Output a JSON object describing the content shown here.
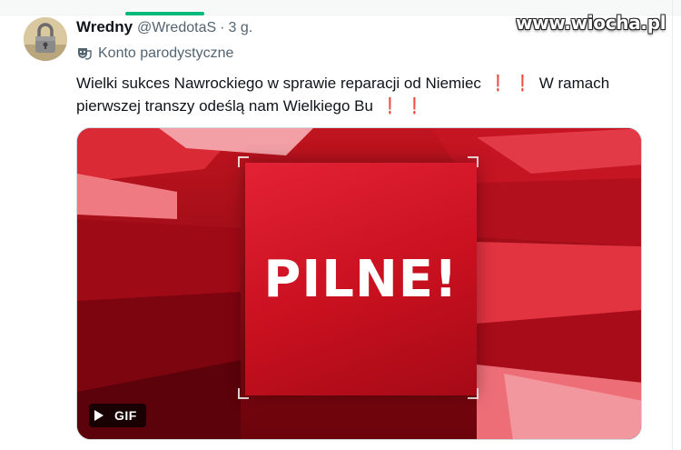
{
  "watermark": {
    "text": "www.wiocha.pl"
  },
  "tweet": {
    "author_name": "Wredny",
    "author_handle": "@WredotaS",
    "separator": "·",
    "time": "3 g.",
    "label": "Konto parodystyczne",
    "label_icon": "theater-mask-icon",
    "text_line1_a": "Wielki sukces Nawrockiego w sprawie reparacji od Niemiec",
    "exclaim": "❗",
    "text_line1_b": "W ramach",
    "text_line2": "pierwszej transzy odeślą nam Wielkiego Bu",
    "media": {
      "banner_text": "PILNE!",
      "badge": "GIF",
      "badge_icon": "play-icon"
    }
  },
  "colors": {
    "accent_green": "#00ba7c",
    "muted_text": "#536471",
    "banner_red": "#d31526"
  }
}
